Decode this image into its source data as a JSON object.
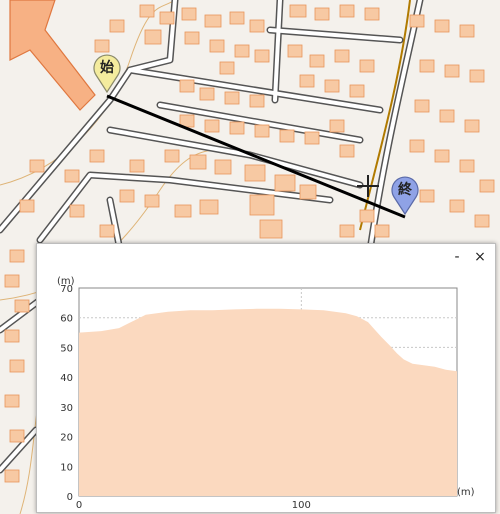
{
  "map": {
    "start_label": "始",
    "end_label": "終",
    "start_color": "#f4ec9e",
    "end_color": "#8fa2e6",
    "building_color": "#f7c9a3",
    "road_color": "#555555",
    "route_color": "#000000"
  },
  "profile_window": {
    "minimize_label": "-",
    "close_label": "×"
  },
  "chart_data": {
    "type": "area",
    "xlabel": "(m)",
    "ylabel": "(m)",
    "xlim": [
      0,
      170
    ],
    "ylim": [
      0,
      70
    ],
    "x_ticks": [
      0,
      100
    ],
    "y_ticks": [
      0,
      10,
      20,
      30,
      40,
      50,
      60,
      70
    ],
    "grid": true,
    "fill_color": "#fbd9bf",
    "series": [
      {
        "x": [
          0,
          10,
          18,
          22,
          26,
          30,
          40,
          50,
          60,
          70,
          80,
          90,
          100,
          110,
          120,
          125,
          130,
          133,
          136,
          140,
          143,
          146,
          150,
          155,
          160,
          165,
          170
        ],
        "y": [
          55,
          55.5,
          56.5,
          58,
          59.5,
          61,
          62,
          62.5,
          62.5,
          62.8,
          63,
          63,
          62.8,
          62.5,
          61.5,
          60.5,
          58.5,
          56,
          53.5,
          50.5,
          48,
          46,
          44.5,
          44,
          43.5,
          42.5,
          42
        ]
      }
    ]
  }
}
